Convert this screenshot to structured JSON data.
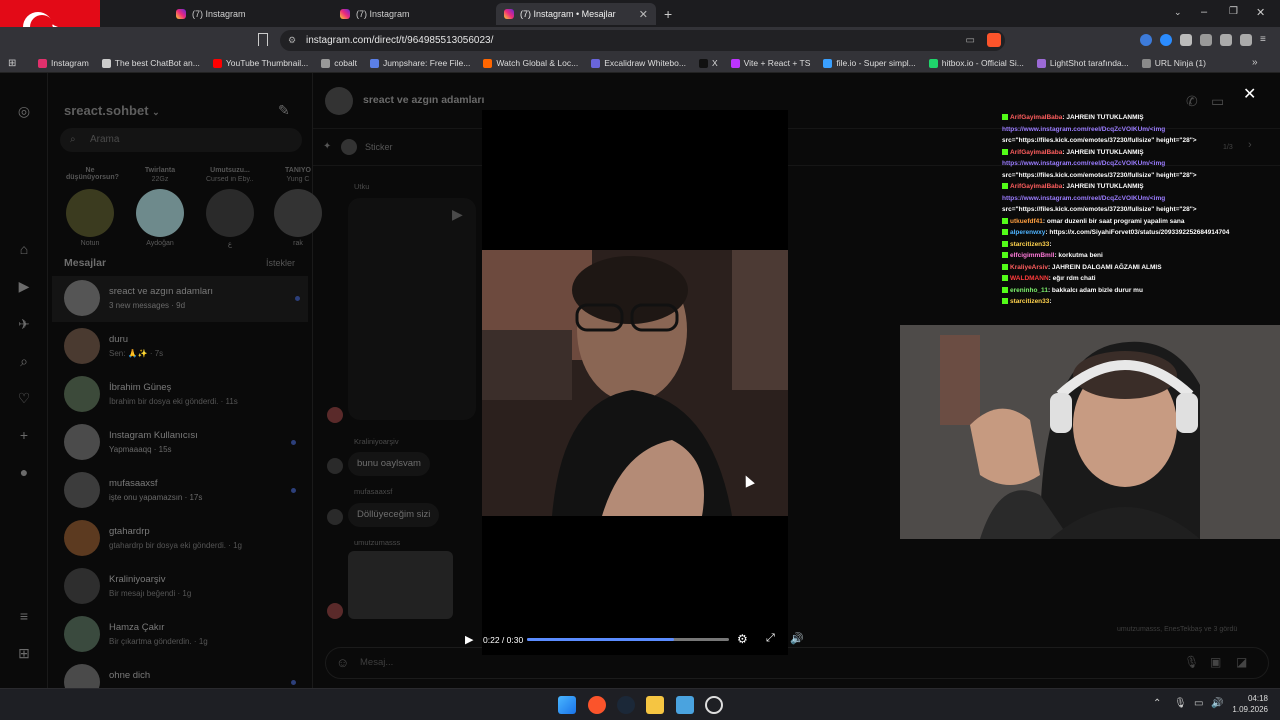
{
  "browser": {
    "tabs": [
      {
        "title": "(7) Instagram"
      },
      {
        "title": "(7) Instagram"
      },
      {
        "title": "(7) Instagram • Mesajlar"
      }
    ],
    "url": "instagram.com/direct/t/964985513056023/",
    "bookmarks": [
      "Instagram",
      "The best ChatBot an...",
      "YouTube Thumbnail...",
      "cobalt",
      "Jumpshare: Free File...",
      "Watch Global & Loc...",
      "Excalidraw Whitebo...",
      "X",
      "Vite + React + TS",
      "file.io - Super simpl...",
      "hitbox.io - Official Si...",
      "LightShot tarafında...",
      "URL Ninja (1)"
    ]
  },
  "inbox": {
    "account": "sreact.sohbet",
    "search_placeholder": "Arama",
    "stories": [
      {
        "note": "Ne düşünüyorsun?",
        "name": "Notun"
      },
      {
        "note": "Twirlanta",
        "sub": "22Gz",
        "name": "Aydoğan"
      },
      {
        "note": "Umutsuzu...",
        "sub": "Cursed in Eby... tuyleriçiken",
        "name": "ع"
      },
      {
        "note": "TANIYO",
        "sub": "Yung C",
        "name": "rak"
      }
    ],
    "section_title": "Mesajlar",
    "requests_label": "İstekler",
    "conversations": [
      {
        "name": "sreact ve azgın adamları",
        "preview": "3 new messages · 9d",
        "unread": true
      },
      {
        "name": "duru",
        "preview": "Sen: 🙏✨ · 7s",
        "unread": false
      },
      {
        "name": "İbrahim Güneş",
        "preview": "İbrahim bir dosya eki gönderdi. · 11s",
        "unread": false
      },
      {
        "name": "Instagram Kullanıcısı",
        "preview": "Yapmaaaqq · 15s",
        "unread": true
      },
      {
        "name": "mufasaaxsf",
        "preview": "işte onu yapamazsın · 17s",
        "unread": true
      },
      {
        "name": "gtahardrp",
        "preview": "gtahardrp bir dosya eki gönderdi. · 1g",
        "unread": false
      },
      {
        "name": "Kraliniyoarşiv",
        "preview": "Bir mesajı beğendi · 1g",
        "unread": false
      },
      {
        "name": "Hamza Çakır",
        "preview": "Bir çıkartma gönderdin. · 1g",
        "unread": false
      },
      {
        "name": "ohne dich",
        "preview": "",
        "unread": true
      }
    ]
  },
  "thread": {
    "title": "sreact ve azgın adamları",
    "pinned": "Sticker",
    "pin_count": "1/3",
    "messages": [
      {
        "sender": "Utku",
        "text": ""
      },
      {
        "sender": "Kraliniyoarşiv",
        "text": "bunu oaylsvam"
      },
      {
        "sender": "mufasaaxsf",
        "text": "Döllüyeceğim sizi"
      },
      {
        "sender": "umutzumasss",
        "text": ""
      }
    ],
    "seen": "umutzumasss, EnesTekbaş ve 3 gördü",
    "composer_placeholder": "Mesaj..."
  },
  "video": {
    "time": "0:22 / 0:30",
    "progress": 0.73
  },
  "chat_overlay": [
    {
      "user": "ArifGayimalBaba",
      "color": "#ff5e5e",
      "msg": ": JAHREIN TUTUKLANMIŞ"
    },
    {
      "user": "",
      "color": "#9b7cff",
      "msg": "https://www.instagram.com/reel/DcqZcVOIKUm/<img"
    },
    {
      "user": "",
      "color": "#fff",
      "msg": "src=\"https://files.kick.com/emotes/37230/fullsize\" height=\"28\">"
    },
    {
      "user": "ArifGayimalBaba",
      "color": "#ff5e5e",
      "msg": ": JAHREIN TUTUKLANMIŞ"
    },
    {
      "user": "",
      "color": "#9b7cff",
      "msg": "https://www.instagram.com/reel/DcqZcVOIKUm/<img"
    },
    {
      "user": "",
      "color": "#fff",
      "msg": "src=\"https://files.kick.com/emotes/37230/fullsize\" height=\"28\">"
    },
    {
      "user": "ArifGayimalBaba",
      "color": "#ff5e5e",
      "msg": ": JAHREIN TUTUKLANMIŞ"
    },
    {
      "user": "",
      "color": "#9b7cff",
      "msg": "https://www.instagram.com/reel/DcqZcVOIKUm/<img"
    },
    {
      "user": "",
      "color": "#fff",
      "msg": "src=\"https://files.kick.com/emotes/37230/fullsize\" height=\"28\">"
    },
    {
      "user": "utkuefdf41",
      "color": "#ff9f40",
      "msg": ": omar duzenli bir saat programi yapalim sana"
    },
    {
      "user": "alperenwxy",
      "color": "#4fb4ff",
      "msg": ": https://x.com/SiyahiForvet03/status/2093392252684914704"
    },
    {
      "user": "starcitizen33",
      "color": "#ffd24d",
      "msg": ":"
    },
    {
      "user": "elfcigimmBmll",
      "color": "#ff7ad9",
      "msg": ": korkutma beni"
    },
    {
      "user": "KraliyeArsiv",
      "color": "#ff5e5e",
      "msg": ": JAHREIN DALGAMI AĞZAMI ALMIS"
    },
    {
      "user": "WALDMANN",
      "color": "#ff3b3b",
      "msg": ": eğır rdm chati"
    },
    {
      "user": "ereninho_11",
      "color": "#7cf06c",
      "msg": ": bakkalcı adam bizle durur mu"
    },
    {
      "user": "starcitizen33",
      "color": "#ffd24d",
      "msg": ":"
    }
  ],
  "taskbar": {
    "time": "04:18",
    "date": "1.09.2026"
  }
}
